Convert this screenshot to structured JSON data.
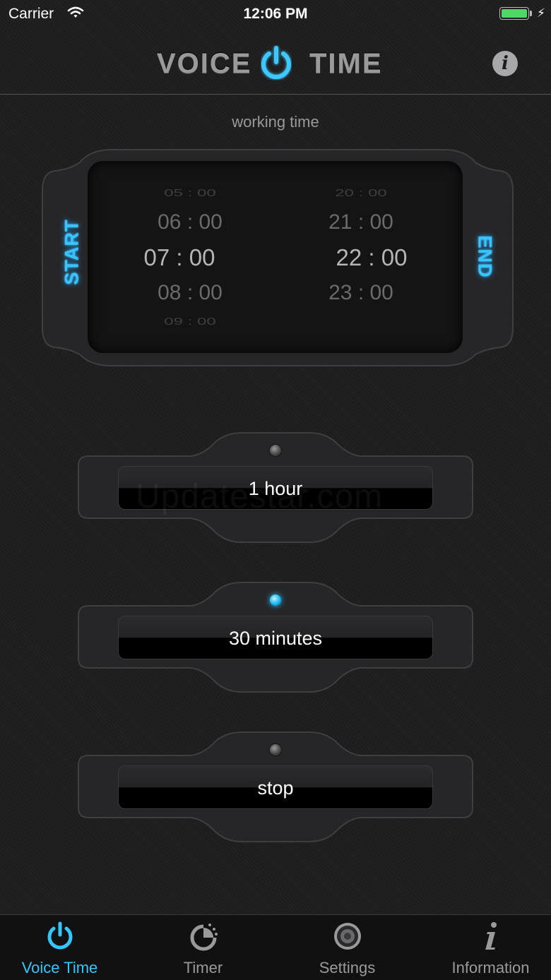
{
  "status_bar": {
    "carrier": "Carrier",
    "time": "12:06 PM"
  },
  "header": {
    "logo_left": "VOICE",
    "logo_right": "TIME",
    "power_icon": "power-icon",
    "info_icon": "info-icon",
    "info_glyph": "i"
  },
  "working_time": {
    "label": "working time",
    "start_label": "START",
    "end_label": "END",
    "start_times": [
      "05 : 00",
      "06 : 00",
      "07 : 00",
      "08 : 00",
      "09 : 00"
    ],
    "end_times": [
      "20 : 00",
      "21 : 00",
      "22 : 00",
      "23 : 00",
      ""
    ],
    "selected_start": "07 : 00",
    "selected_end": "22 : 00"
  },
  "options": [
    {
      "label": "1 hour",
      "led": "off"
    },
    {
      "label": "30 minutes",
      "led": "on"
    },
    {
      "label": "stop",
      "led": "off"
    }
  ],
  "watermark": "Updatestar.com",
  "tabs": [
    {
      "label": "Voice Time",
      "icon": "power-icon",
      "active": true
    },
    {
      "label": "Timer",
      "icon": "timer-icon",
      "active": false
    },
    {
      "label": "Settings",
      "icon": "speaker-icon",
      "active": false
    },
    {
      "label": "Information",
      "icon": "info-icon",
      "active": false
    }
  ],
  "colors": {
    "accent": "#37c5ff",
    "background": "#1e1e1f",
    "battery": "#4cd964",
    "muted_text": "#9a9a9c"
  }
}
